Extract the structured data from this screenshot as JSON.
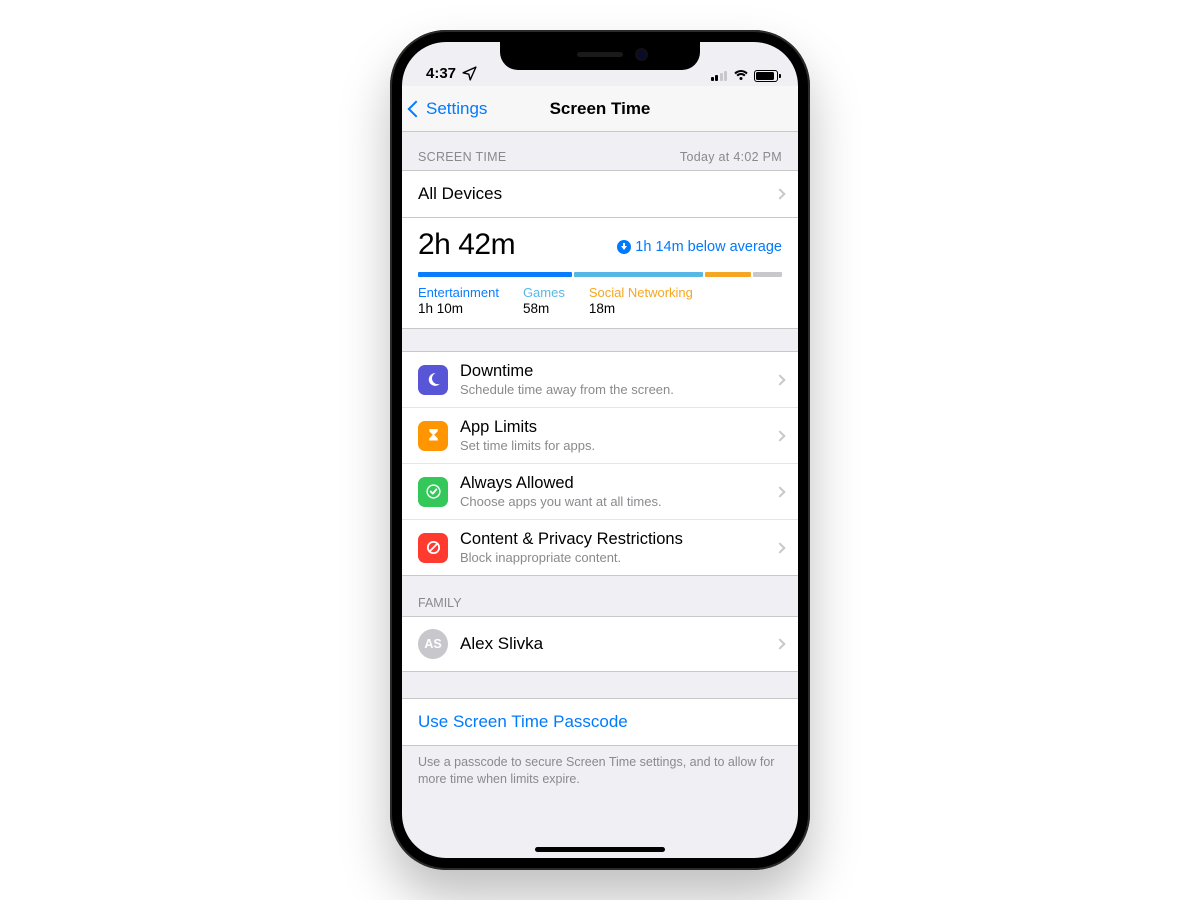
{
  "statusbar": {
    "time": "4:37"
  },
  "nav": {
    "back": "Settings",
    "title": "Screen Time"
  },
  "summary_header": {
    "left": "Screen Time",
    "right": "Today at 4:02 PM"
  },
  "device_row": {
    "label": "All Devices"
  },
  "summary": {
    "total": "2h 42m",
    "delta_text": "1h 14m below average",
    "categories": [
      {
        "name": "Entertainment",
        "time": "1h 10m",
        "color": "#0a7dff",
        "weight": 43
      },
      {
        "name": "Games",
        "time": "58m",
        "color": "#57b8e8",
        "weight": 36
      },
      {
        "name": "Social Networking",
        "time": "18m",
        "color": "#f5a623",
        "weight": 13
      }
    ],
    "remainder_weight": 8,
    "remainder_color": "#c7c7cc"
  },
  "options": [
    {
      "icon": "moon",
      "color_class": "ic-purple",
      "title": "Downtime",
      "sub": "Schedule time away from the screen."
    },
    {
      "icon": "hourglass",
      "color_class": "ic-orange",
      "title": "App Limits",
      "sub": "Set time limits for apps."
    },
    {
      "icon": "check",
      "color_class": "ic-green",
      "title": "Always Allowed",
      "sub": "Choose apps you want at all times."
    },
    {
      "icon": "nosign",
      "color_class": "ic-red",
      "title": "Content & Privacy Restrictions",
      "sub": "Block inappropriate content."
    }
  ],
  "family": {
    "header": "Family",
    "member_initials": "AS",
    "member_name": "Alex Slivka"
  },
  "passcode": {
    "link": "Use Screen Time Passcode",
    "footer": "Use a passcode to secure Screen Time settings, and to allow for more time when limits expire."
  }
}
